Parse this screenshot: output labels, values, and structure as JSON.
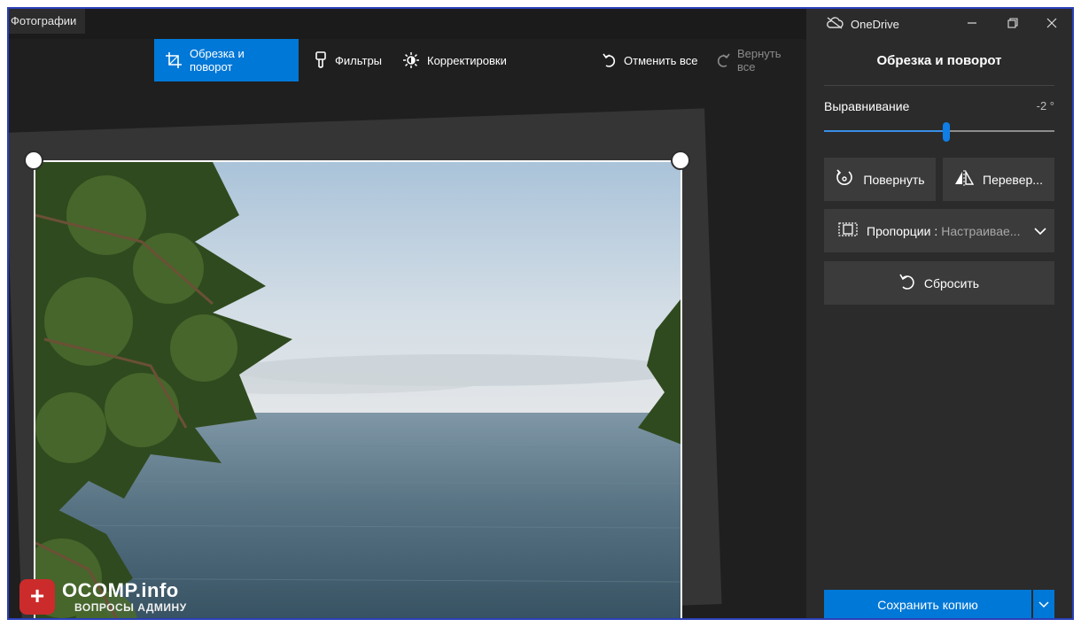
{
  "app": {
    "title": "Фотографии"
  },
  "toolbar": {
    "crop_rotate": "Обрезка и поворот",
    "filters": "Фильтры",
    "adjustments": "Корректировки",
    "undo_all": "Отменить все",
    "redo_all": "Вернуть все"
  },
  "window": {
    "onedrive": "OneDrive",
    "minimize_icon": "minimize-icon",
    "restore_icon": "restore-icon",
    "close_icon": "close-icon"
  },
  "panel": {
    "title": "Обрезка и поворот",
    "straighten_label": "Выравнивание",
    "straighten_value": "-2 °",
    "straighten_level": 0.53,
    "rotate_label": "Повернуть",
    "flip_label": "Перевер...",
    "aspect_label": "Пропорции :",
    "aspect_value": "Настраивае...",
    "reset_label": "Сбросить",
    "save_copy_label": "Сохранить копию"
  },
  "watermark": {
    "badge": "+",
    "main": "OCOMP.info",
    "sub": "ВОПРОСЫ АДМИНУ"
  },
  "colors": {
    "accent": "#0078d7",
    "panel_bg": "#2b2b2b",
    "canvas_bg": "#1f1f1f"
  }
}
